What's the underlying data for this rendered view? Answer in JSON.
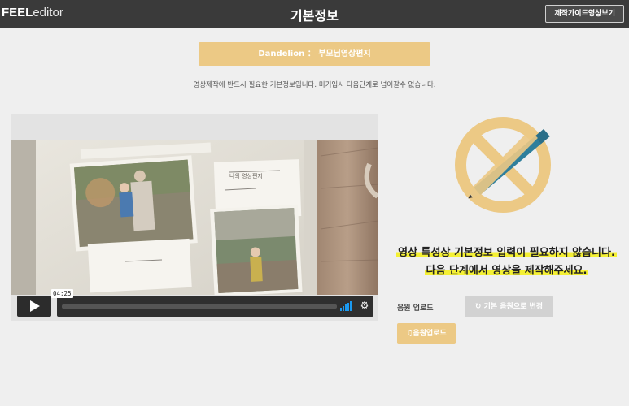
{
  "header": {
    "logo_bold": "FEEL",
    "logo_thin": "editor",
    "title": "기본정보",
    "guide_button": "제작가이드영상보기"
  },
  "product": {
    "label": "Dandelion ： 부모님영상편지"
  },
  "notice": "영상제작에 반드시 필요한 기본정보입니다. 미기입시 다음단계로 넘어갈수 없습니다.",
  "player": {
    "time": "04:25",
    "play_icon": "play-icon",
    "volume_icon": "volume-icon",
    "settings_icon": "gear-icon"
  },
  "info": {
    "line1": "영상 특성상 기본정보 입력이 필요하지 않습니다.",
    "line2": "다음 단계에서 영상을 제작해주세요."
  },
  "music": {
    "label": "음원 업로드",
    "reset_button": "기본 음원으로 변경",
    "upload_button": "음원업로드"
  },
  "colors": {
    "topbar": "#3a3a3a",
    "accent": "#ecc985",
    "highlight": "#f4f034",
    "pencil": "#2f7f9c"
  }
}
